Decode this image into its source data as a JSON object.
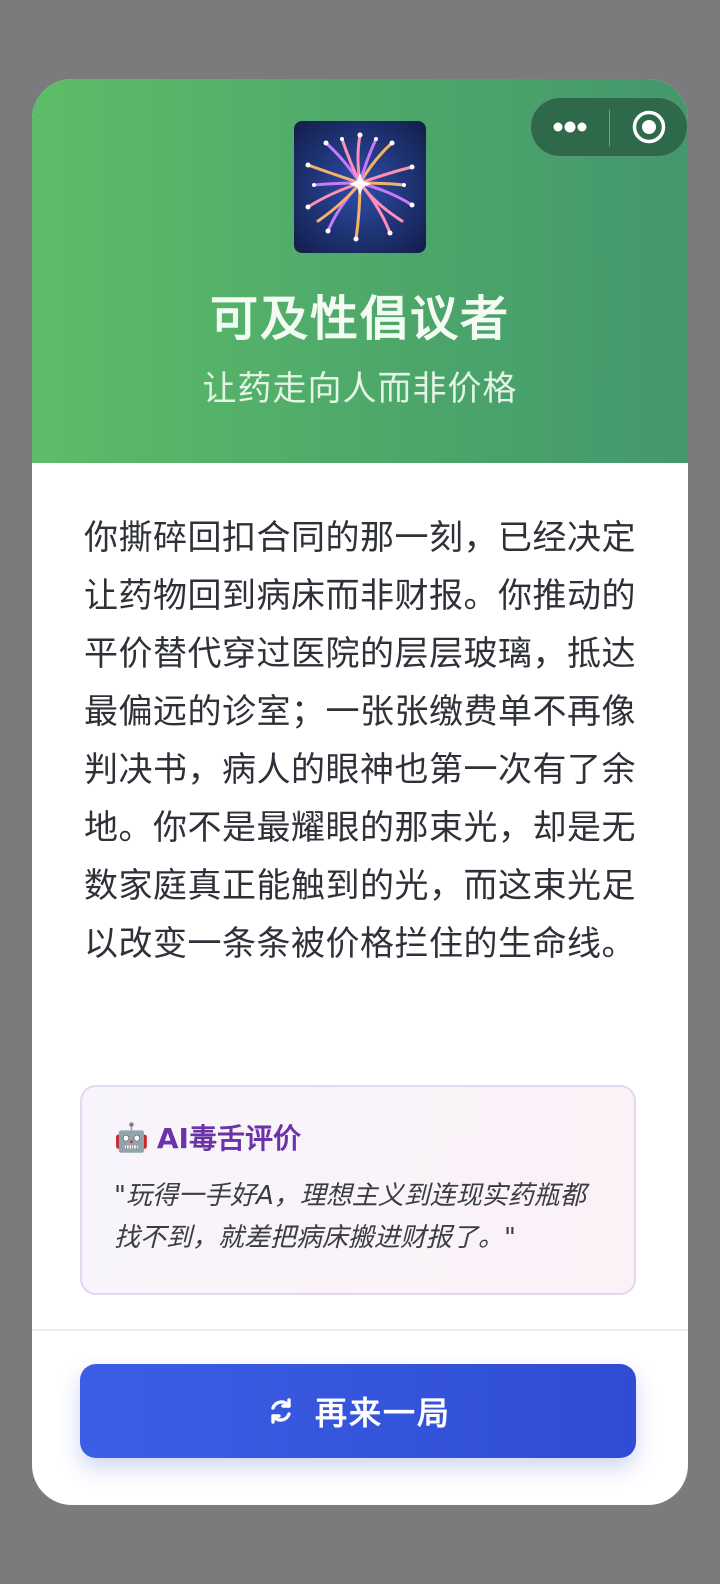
{
  "header": {
    "title": "可及性倡议者",
    "subtitle": "让药走向人而非价格",
    "badge_icon": "fireworks-icon"
  },
  "story": {
    "text": "你撕碎回扣合同的那一刻，已经决定让药物回到病床而非财报。你推动的平价替代穿过医院的层层玻璃，抵达最偏远的诊室；一张张缴费单不再像判决书，病人的眼神也第一次有了余地。你不是最耀眼的那束光，却是无数家庭真正能触到的光，而这束光足以改变一条条被价格拦住的生命线。"
  },
  "ai_review": {
    "icon": "🤖",
    "title": "AI毒舌评价",
    "quote": "\"玩得一手好A，理想主义到连现实药瓶都找不到，就差把病床搬进财报了。\""
  },
  "actions": {
    "retry_label": "再来一局"
  },
  "capsule": {
    "more_icon": "more-dots-icon",
    "close_icon": "target-close-icon"
  },
  "colors": {
    "header_start": "#5dbd67",
    "header_end": "#43986c",
    "button": "#3c5ee6",
    "ai_title": "#6a34a8"
  }
}
